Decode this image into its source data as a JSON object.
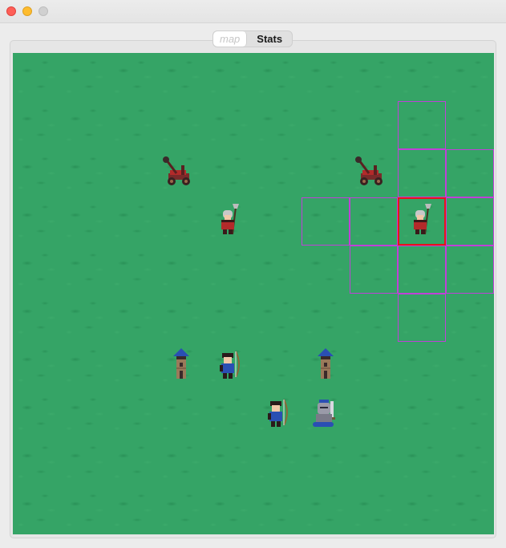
{
  "window": {
    "controls": [
      "close-icon",
      "minimize-icon",
      "maximize-icon"
    ]
  },
  "tabs": [
    {
      "label": "map",
      "selected": true
    },
    {
      "label": "Stats",
      "selected": false
    }
  ],
  "board": {
    "columns": 10,
    "rows": 10,
    "terrain": "grass",
    "colors": {
      "grass": "#35a466",
      "range_outline": "#c040d8",
      "selection_outline": "#e8141a",
      "red_team": "#b32a2a",
      "blue_team": "#2a4fb3"
    },
    "units": [
      {
        "type": "catapult",
        "team": "red",
        "col": 3,
        "row": 2
      },
      {
        "type": "catapult",
        "team": "red",
        "col": 7,
        "row": 2
      },
      {
        "type": "pikeman",
        "team": "red",
        "col": 4,
        "row": 3
      },
      {
        "type": "pikeman",
        "team": "red",
        "col": 8,
        "row": 3,
        "selected": true
      },
      {
        "type": "tower",
        "team": "blue",
        "col": 3,
        "row": 6
      },
      {
        "type": "archer",
        "team": "blue",
        "col": 4,
        "row": 6
      },
      {
        "type": "tower",
        "team": "blue",
        "col": 6,
        "row": 6
      },
      {
        "type": "archer",
        "team": "blue",
        "col": 5,
        "row": 7
      },
      {
        "type": "knight",
        "team": "blue",
        "col": 6,
        "row": 7
      }
    ],
    "selected": {
      "col": 8,
      "row": 3
    },
    "range_cells": [
      {
        "col": 8,
        "row": 1
      },
      {
        "col": 8,
        "row": 2
      },
      {
        "col": 9,
        "row": 2
      },
      {
        "col": 6,
        "row": 3
      },
      {
        "col": 7,
        "row": 3
      },
      {
        "col": 9,
        "row": 3
      },
      {
        "col": 7,
        "row": 4
      },
      {
        "col": 8,
        "row": 4
      },
      {
        "col": 9,
        "row": 4
      },
      {
        "col": 8,
        "row": 5
      }
    ]
  }
}
